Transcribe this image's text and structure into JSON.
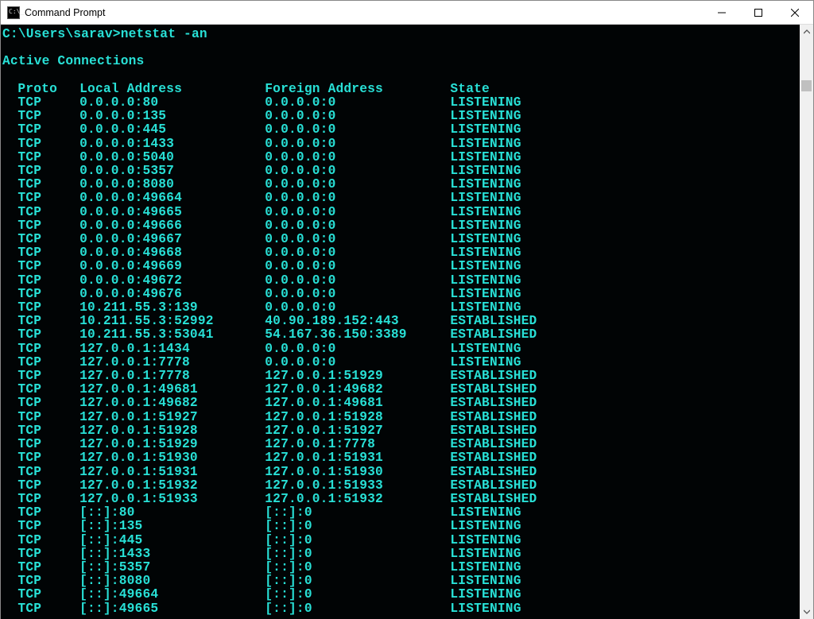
{
  "window": {
    "title": "Command Prompt"
  },
  "terminal": {
    "prompt": "C:\\Users\\sarav>",
    "command": "netstat -an",
    "section_title": "Active Connections",
    "headers": {
      "proto": "Proto",
      "local": "Local Address",
      "foreign": "Foreign Address",
      "state": "State"
    },
    "rows": [
      {
        "proto": "TCP",
        "local": "0.0.0.0:80",
        "foreign": "0.0.0.0:0",
        "state": "LISTENING"
      },
      {
        "proto": "TCP",
        "local": "0.0.0.0:135",
        "foreign": "0.0.0.0:0",
        "state": "LISTENING"
      },
      {
        "proto": "TCP",
        "local": "0.0.0.0:445",
        "foreign": "0.0.0.0:0",
        "state": "LISTENING"
      },
      {
        "proto": "TCP",
        "local": "0.0.0.0:1433",
        "foreign": "0.0.0.0:0",
        "state": "LISTENING"
      },
      {
        "proto": "TCP",
        "local": "0.0.0.0:5040",
        "foreign": "0.0.0.0:0",
        "state": "LISTENING"
      },
      {
        "proto": "TCP",
        "local": "0.0.0.0:5357",
        "foreign": "0.0.0.0:0",
        "state": "LISTENING"
      },
      {
        "proto": "TCP",
        "local": "0.0.0.0:8080",
        "foreign": "0.0.0.0:0",
        "state": "LISTENING"
      },
      {
        "proto": "TCP",
        "local": "0.0.0.0:49664",
        "foreign": "0.0.0.0:0",
        "state": "LISTENING"
      },
      {
        "proto": "TCP",
        "local": "0.0.0.0:49665",
        "foreign": "0.0.0.0:0",
        "state": "LISTENING"
      },
      {
        "proto": "TCP",
        "local": "0.0.0.0:49666",
        "foreign": "0.0.0.0:0",
        "state": "LISTENING"
      },
      {
        "proto": "TCP",
        "local": "0.0.0.0:49667",
        "foreign": "0.0.0.0:0",
        "state": "LISTENING"
      },
      {
        "proto": "TCP",
        "local": "0.0.0.0:49668",
        "foreign": "0.0.0.0:0",
        "state": "LISTENING"
      },
      {
        "proto": "TCP",
        "local": "0.0.0.0:49669",
        "foreign": "0.0.0.0:0",
        "state": "LISTENING"
      },
      {
        "proto": "TCP",
        "local": "0.0.0.0:49672",
        "foreign": "0.0.0.0:0",
        "state": "LISTENING"
      },
      {
        "proto": "TCP",
        "local": "0.0.0.0:49676",
        "foreign": "0.0.0.0:0",
        "state": "LISTENING"
      },
      {
        "proto": "TCP",
        "local": "10.211.55.3:139",
        "foreign": "0.0.0.0:0",
        "state": "LISTENING"
      },
      {
        "proto": "TCP",
        "local": "10.211.55.3:52992",
        "foreign": "40.90.189.152:443",
        "state": "ESTABLISHED"
      },
      {
        "proto": "TCP",
        "local": "10.211.55.3:53041",
        "foreign": "54.167.36.150:3389",
        "state": "ESTABLISHED"
      },
      {
        "proto": "TCP",
        "local": "127.0.0.1:1434",
        "foreign": "0.0.0.0:0",
        "state": "LISTENING"
      },
      {
        "proto": "TCP",
        "local": "127.0.0.1:7778",
        "foreign": "0.0.0.0:0",
        "state": "LISTENING"
      },
      {
        "proto": "TCP",
        "local": "127.0.0.1:7778",
        "foreign": "127.0.0.1:51929",
        "state": "ESTABLISHED"
      },
      {
        "proto": "TCP",
        "local": "127.0.0.1:49681",
        "foreign": "127.0.0.1:49682",
        "state": "ESTABLISHED"
      },
      {
        "proto": "TCP",
        "local": "127.0.0.1:49682",
        "foreign": "127.0.0.1:49681",
        "state": "ESTABLISHED"
      },
      {
        "proto": "TCP",
        "local": "127.0.0.1:51927",
        "foreign": "127.0.0.1:51928",
        "state": "ESTABLISHED"
      },
      {
        "proto": "TCP",
        "local": "127.0.0.1:51928",
        "foreign": "127.0.0.1:51927",
        "state": "ESTABLISHED"
      },
      {
        "proto": "TCP",
        "local": "127.0.0.1:51929",
        "foreign": "127.0.0.1:7778",
        "state": "ESTABLISHED"
      },
      {
        "proto": "TCP",
        "local": "127.0.0.1:51930",
        "foreign": "127.0.0.1:51931",
        "state": "ESTABLISHED"
      },
      {
        "proto": "TCP",
        "local": "127.0.0.1:51931",
        "foreign": "127.0.0.1:51930",
        "state": "ESTABLISHED"
      },
      {
        "proto": "TCP",
        "local": "127.0.0.1:51932",
        "foreign": "127.0.0.1:51933",
        "state": "ESTABLISHED"
      },
      {
        "proto": "TCP",
        "local": "127.0.0.1:51933",
        "foreign": "127.0.0.1:51932",
        "state": "ESTABLISHED"
      },
      {
        "proto": "TCP",
        "local": "[::]:80",
        "foreign": "[::]:0",
        "state": "LISTENING"
      },
      {
        "proto": "TCP",
        "local": "[::]:135",
        "foreign": "[::]:0",
        "state": "LISTENING"
      },
      {
        "proto": "TCP",
        "local": "[::]:445",
        "foreign": "[::]:0",
        "state": "LISTENING"
      },
      {
        "proto": "TCP",
        "local": "[::]:1433",
        "foreign": "[::]:0",
        "state": "LISTENING"
      },
      {
        "proto": "TCP",
        "local": "[::]:5357",
        "foreign": "[::]:0",
        "state": "LISTENING"
      },
      {
        "proto": "TCP",
        "local": "[::]:8080",
        "foreign": "[::]:0",
        "state": "LISTENING"
      },
      {
        "proto": "TCP",
        "local": "[::]:49664",
        "foreign": "[::]:0",
        "state": "LISTENING"
      },
      {
        "proto": "TCP",
        "local": "[::]:49665",
        "foreign": "[::]:0",
        "state": "LISTENING"
      }
    ]
  }
}
